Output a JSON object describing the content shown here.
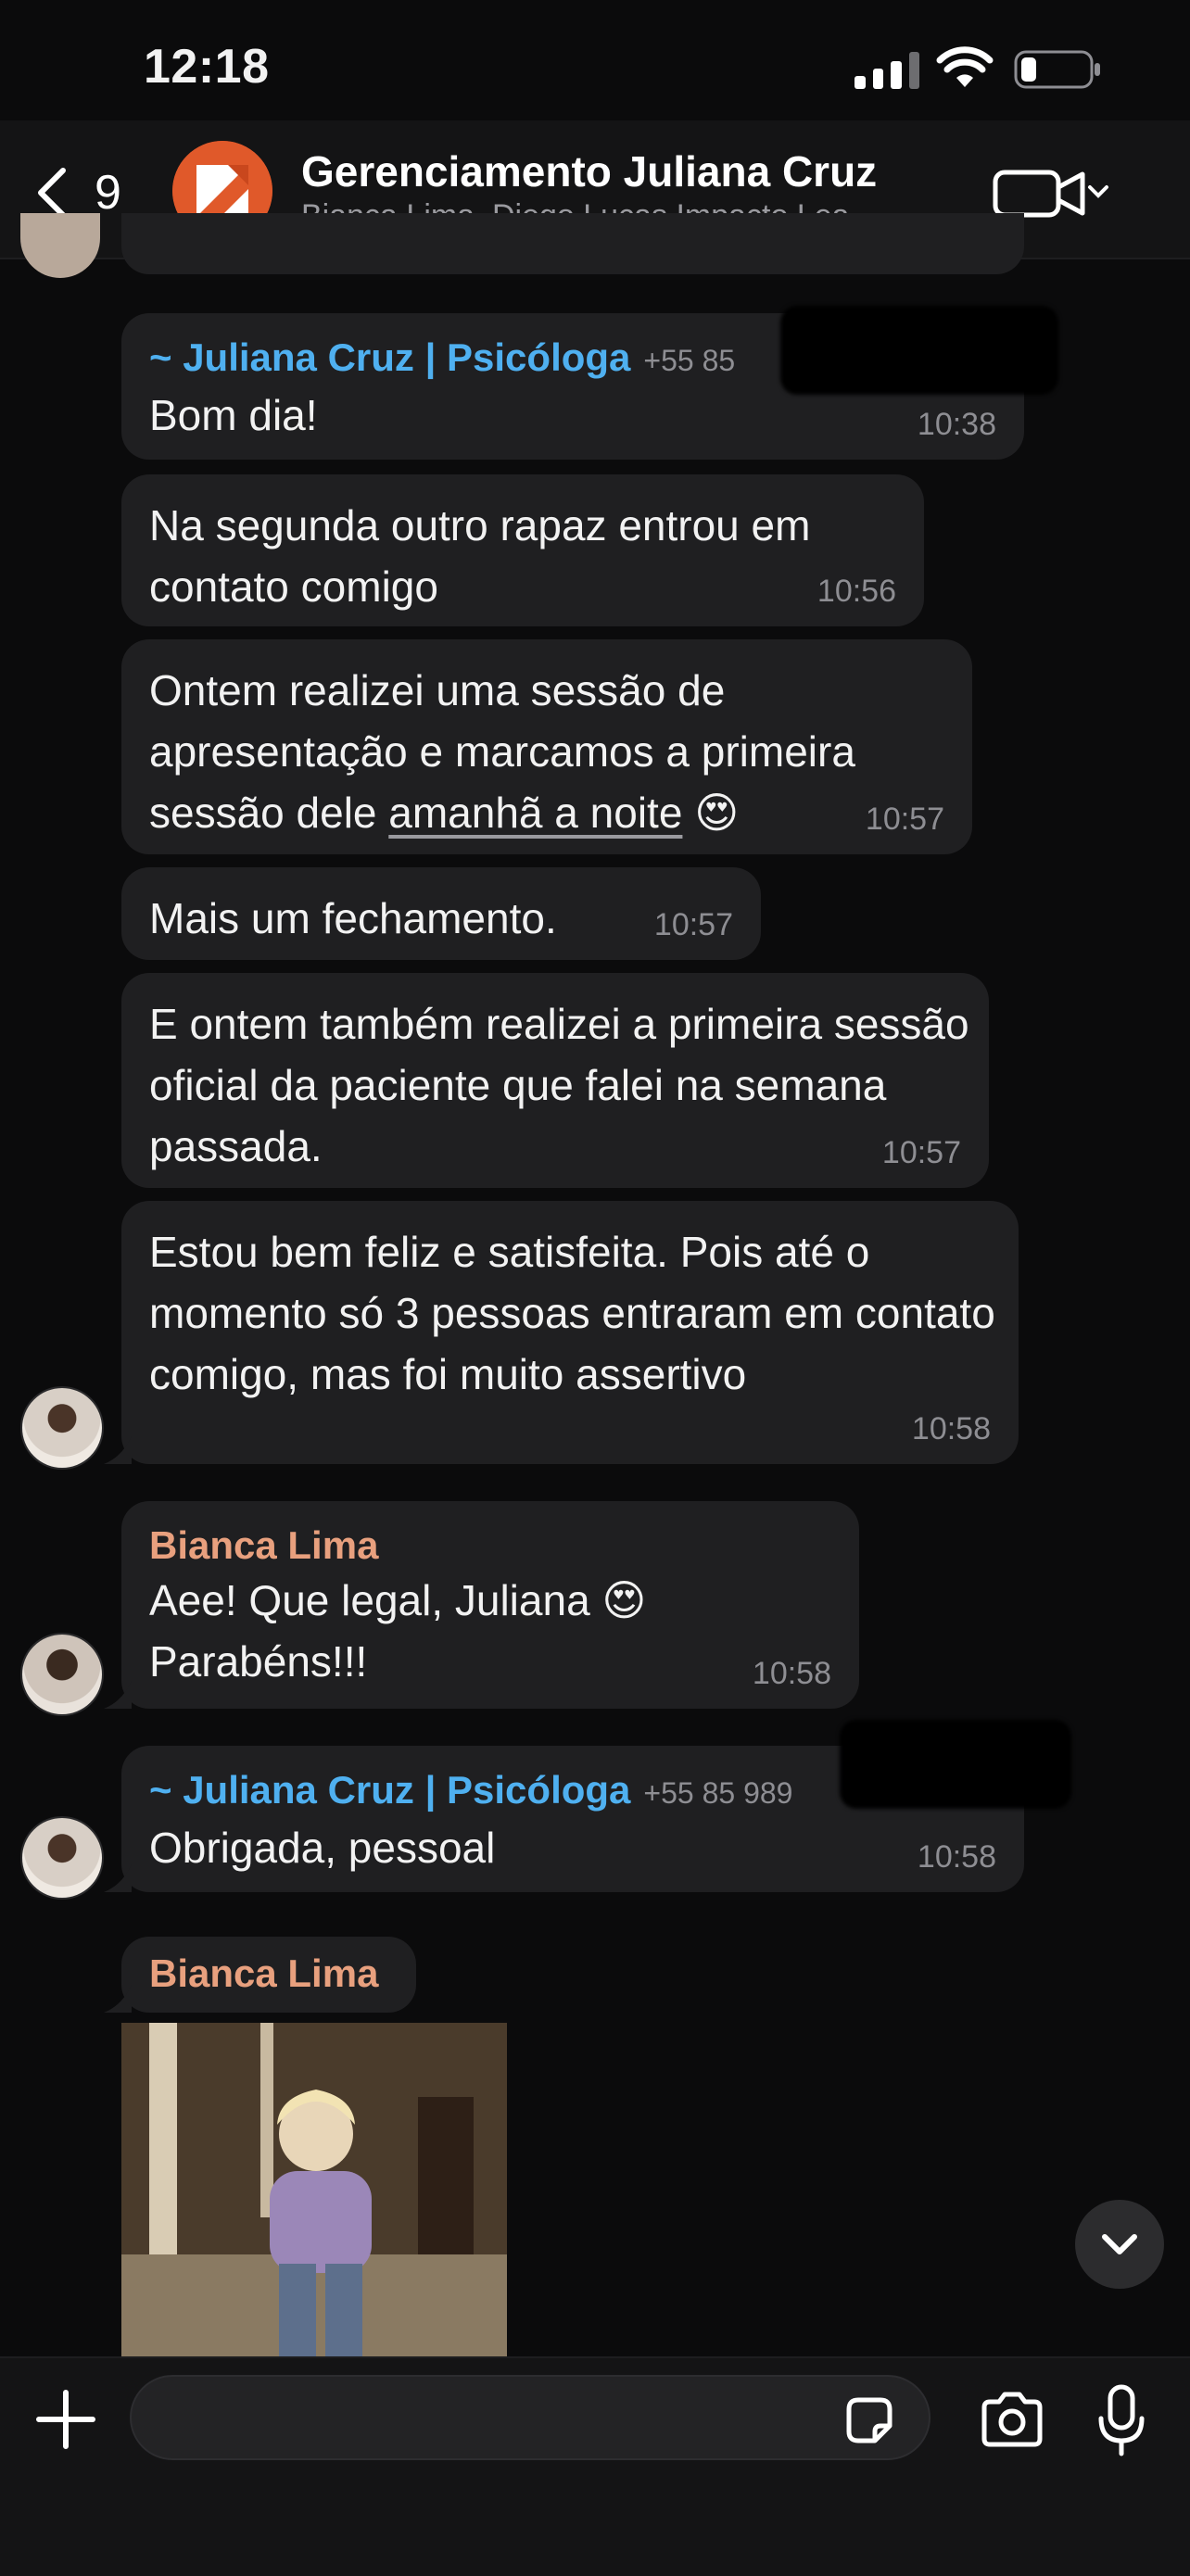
{
  "status_bar": {
    "time": "12:18"
  },
  "header": {
    "back_count": "9",
    "title": "Gerenciamento Juliana Cruz",
    "members": "Bianca Lima, Diego Lucas Impacto Lea..."
  },
  "messages": [
    {
      "sender": "~ Juliana Cruz | Psicóloga",
      "phone": "+55 85",
      "text": "Bom dia!",
      "time": "10:38"
    },
    {
      "text": "Na segunda outro rapaz entrou em contato comigo",
      "time": "10:56"
    },
    {
      "text_before": "Ontem realizei uma sessão de apresentação e marcamos a primeira sessão dele ",
      "link": "amanhã a noite",
      "emoji": "😍",
      "time": "10:57"
    },
    {
      "text": "Mais um fechamento.",
      "time": "10:57"
    },
    {
      "text": "E ontem também realizei a primeira sessão oficial da paciente que falei na semana passada.",
      "time": "10:57"
    },
    {
      "text": "Estou bem feliz e satisfeita. Pois até o momento só 3 pessoas entraram em contato comigo, mas foi muito assertivo",
      "time": "10:58"
    },
    {
      "sender": "Bianca Lima",
      "text_line1": "Aee! Que legal, Juliana 😍",
      "text_line2": "Parabéns!!!",
      "time": "10:58"
    },
    {
      "sender": "~ Juliana Cruz | Psicóloga",
      "phone": "+55 85 989",
      "text": "Obrigada, pessoal",
      "time": "10:58"
    },
    {
      "sender": "Bianca Lima",
      "media": "gif"
    }
  ],
  "input": {
    "placeholder": ""
  },
  "colors": {
    "juliana": "#4fb0f0",
    "bianca": "#e8a07e",
    "bubble": "#1f1f21",
    "background": "#0b0b0c"
  },
  "icons": [
    "back-chevron-icon",
    "video-camera-icon",
    "chevron-down-icon",
    "plus-icon",
    "sticker-icon",
    "camera-icon",
    "microphone-icon"
  ]
}
